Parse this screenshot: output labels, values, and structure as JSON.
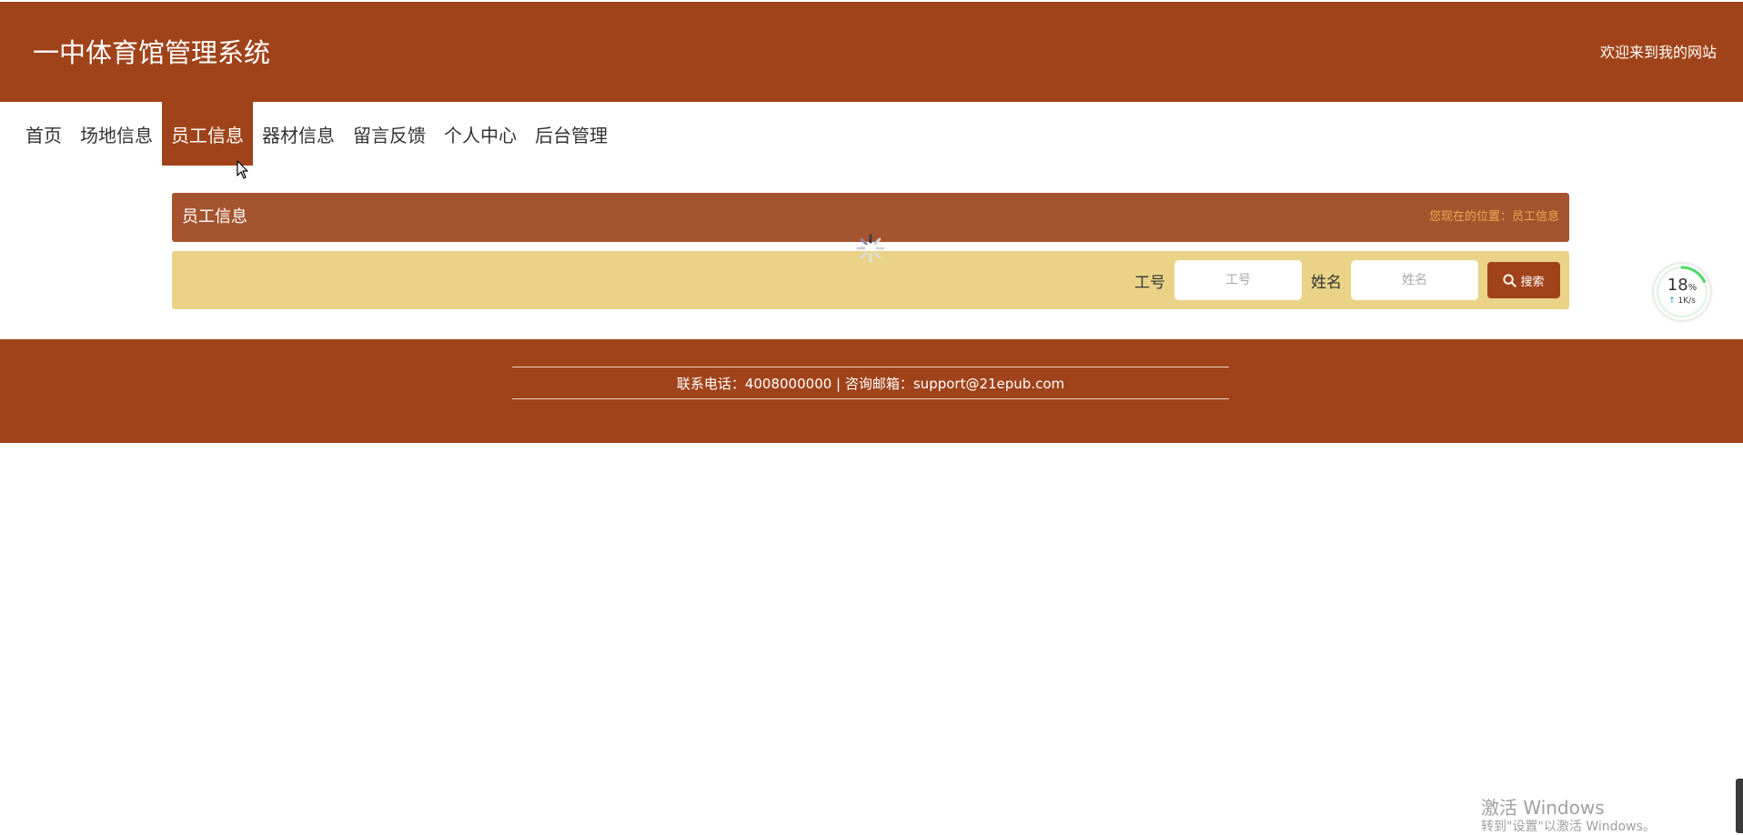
{
  "header": {
    "site_title": "一中体育馆管理系统",
    "welcome_text": "欢迎来到我的网站"
  },
  "nav": {
    "items": [
      {
        "label": "首页"
      },
      {
        "label": "场地信息"
      },
      {
        "label": "员工信息",
        "active": true
      },
      {
        "label": "器材信息"
      },
      {
        "label": "留言反馈"
      },
      {
        "label": "个人中心"
      },
      {
        "label": "后台管理"
      }
    ]
  },
  "page": {
    "title": "员工信息",
    "breadcrumb": "您现在的位置：员工信息"
  },
  "search": {
    "fields": [
      {
        "label": "工号",
        "placeholder": "工号",
        "value": ""
      },
      {
        "label": "姓名",
        "placeholder": "姓名",
        "value": ""
      }
    ],
    "button_label": "搜索"
  },
  "footer": {
    "contact": "联系电话：4008000000 | 咨询邮箱：support@21epub.com"
  },
  "net_widget": {
    "percent": "18",
    "percent_unit": "%",
    "speed": "1K/s",
    "progress": 0.18
  },
  "windows_watermark": {
    "title": "激活 Windows",
    "subtitle": "转到\"设置\"以激活 Windows。"
  },
  "colors": {
    "brand": "#a0431a",
    "panel_head": "#a65430",
    "search_bar": "#ead386",
    "breadcrumb": "#f0a64e"
  }
}
